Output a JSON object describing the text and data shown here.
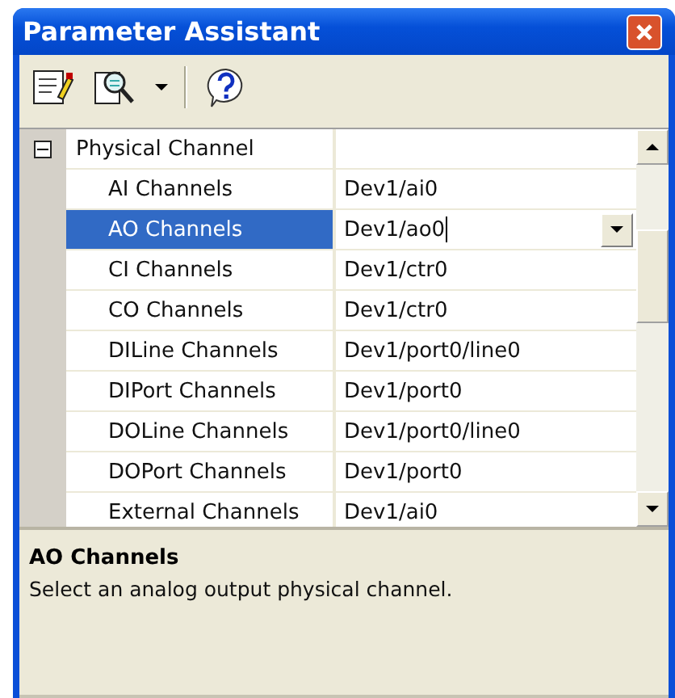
{
  "window": {
    "title": "Parameter Assistant"
  },
  "grid": {
    "category": {
      "label": "Physical Channel",
      "expanded": true
    },
    "rows": [
      {
        "name": "AI Channels",
        "value": "Dev1/ai0",
        "selected": false
      },
      {
        "name": "AO Channels",
        "value": "Dev1/ao0",
        "selected": true
      },
      {
        "name": "CI Channels",
        "value": "Dev1/ctr0",
        "selected": false
      },
      {
        "name": "CO Channels",
        "value": "Dev1/ctr0",
        "selected": false
      },
      {
        "name": "DILine Channels",
        "value": "Dev1/port0/line0",
        "selected": false
      },
      {
        "name": "DIPort Channels",
        "value": "Dev1/port0",
        "selected": false
      },
      {
        "name": "DOLine Channels",
        "value": "Dev1/port0/line0",
        "selected": false
      },
      {
        "name": "DOPort Channels",
        "value": "Dev1/port0",
        "selected": false
      },
      {
        "name": "External Channels",
        "value": "Dev1/ai0",
        "selected": false
      }
    ]
  },
  "description": {
    "title": "AO Channels",
    "text": "Select an analog output physical channel."
  }
}
